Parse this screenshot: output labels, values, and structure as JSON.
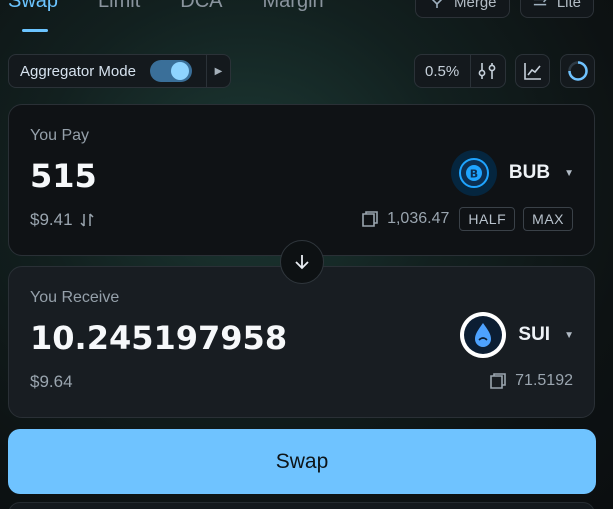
{
  "tabs": [
    {
      "label": "Swap",
      "active": true
    },
    {
      "label": "Limit",
      "active": false
    },
    {
      "label": "DCA",
      "active": false
    },
    {
      "label": "Margin",
      "active": false
    }
  ],
  "top_buttons": {
    "merge": "Merge",
    "lite": "Lite"
  },
  "toolbar": {
    "aggregator_label": "Aggregator Mode",
    "aggregator_enabled": true,
    "slippage": "0.5%",
    "icons": [
      "sliders-icon",
      "chart-icon",
      "refresh-icon"
    ]
  },
  "pay": {
    "label": "You Pay",
    "amount": "515",
    "usd": "$9.41",
    "token": "BUB",
    "balance": "1,036.47",
    "half_label": "HALF",
    "max_label": "MAX"
  },
  "receive": {
    "label": "You Receive",
    "amount": "10.245197958",
    "usd": "$9.64",
    "token": "SUI",
    "balance": "71.5192"
  },
  "swap_button": "Swap",
  "colors": {
    "accent": "#6fc3ff",
    "bub_logo": "#1fa4ff",
    "sui_logo": "#4da2ff",
    "card_dark": "#0f1215",
    "card_receive": "#181d22"
  }
}
